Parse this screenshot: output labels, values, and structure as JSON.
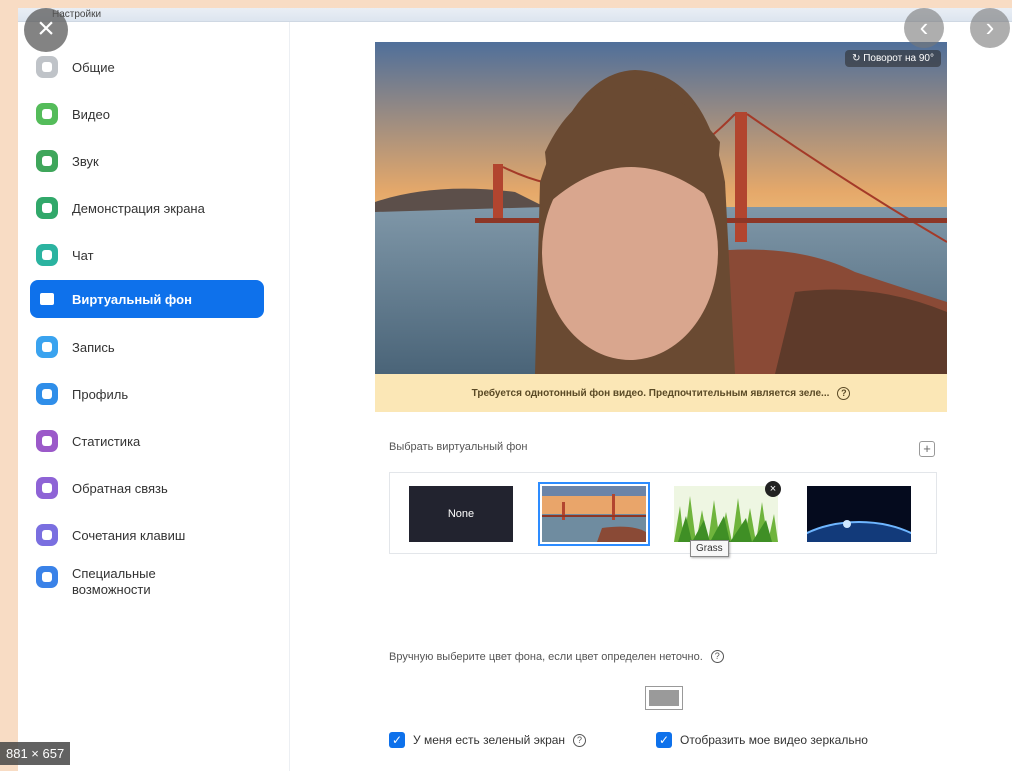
{
  "window": {
    "title": "Настройки"
  },
  "sidebar": {
    "items": [
      {
        "label": "Общие",
        "color": "#bfc3c8"
      },
      {
        "label": "Видео",
        "color": "#54bc5a"
      },
      {
        "label": "Звук",
        "color": "#3fa65b"
      },
      {
        "label": "Демонстрация экрана",
        "color": "#31a86a"
      },
      {
        "label": "Чат",
        "color": "#2bb3a0"
      },
      {
        "label": "Виртуальный фон",
        "color": "#0e71eb"
      },
      {
        "label": "Запись",
        "color": "#3aa3ef"
      },
      {
        "label": "Профиль",
        "color": "#2f8ee9"
      },
      {
        "label": "Статистика",
        "color": "#9b59c9"
      },
      {
        "label": "Обратная связь",
        "color": "#8e63d6"
      },
      {
        "label": "Сочетания клавиш",
        "color": "#7a6fe0"
      },
      {
        "label": "Специальные возможности",
        "color": "#3a82e8"
      }
    ]
  },
  "preview": {
    "rotate_label": "Поворот на 90°"
  },
  "warning": {
    "text": "Требуется однотонный фон видео. Предпочтительным является зеле...",
    "help": "?"
  },
  "backgrounds": {
    "title": "Выбрать виртуальный фон",
    "add": "+",
    "items": [
      {
        "label": "None"
      },
      {
        "label": "Golden Gate"
      },
      {
        "label": "Grass"
      },
      {
        "label": "Earth"
      }
    ],
    "remove": "×",
    "tooltip": "Grass"
  },
  "manual": {
    "label": "Вручную выберите цвет фона, если цвет определен неточно.",
    "help": "?",
    "color": "#9a9a9a"
  },
  "checks": {
    "green_screen": {
      "label": "У меня есть зеленый экран",
      "help": "?",
      "checked": true
    },
    "mirror": {
      "label": "Отобразить мое видео зеркально",
      "checked": true
    }
  },
  "overlay": {
    "close": "×",
    "prev": "‹",
    "next": "›",
    "dimensions": "881 × 657"
  }
}
